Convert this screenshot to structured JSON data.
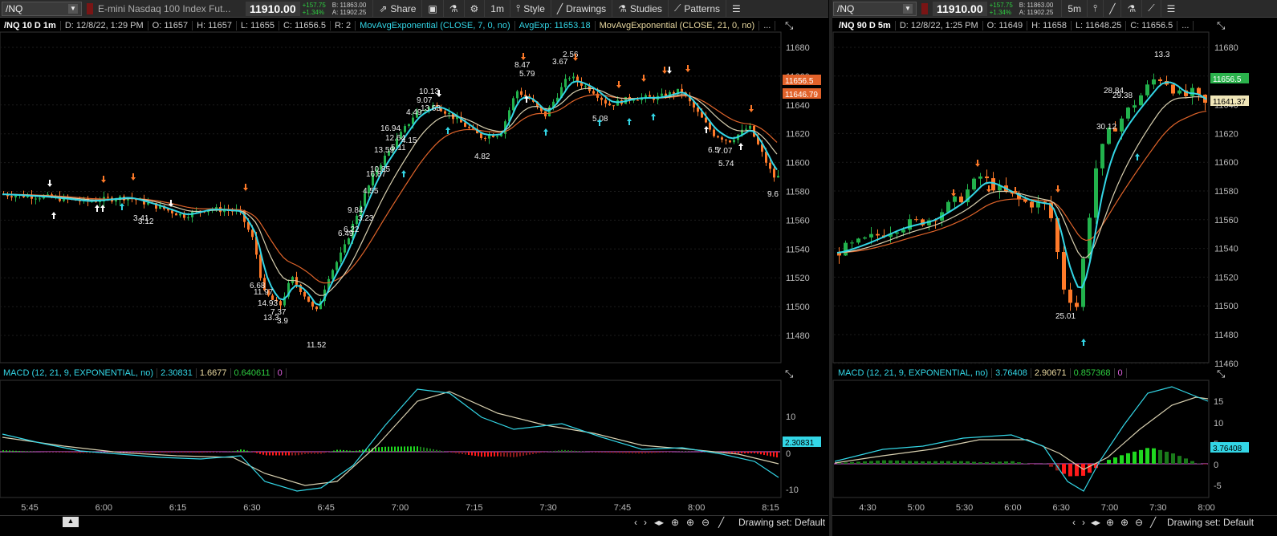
{
  "colors": {
    "up": "#22b24c",
    "down": "#ff7a29",
    "ema7": "#33d6e6",
    "ema_mid": "#d8d0b0",
    "ema21": "#e0642a",
    "macd": "#33d6e6",
    "signal": "#d8d0b0",
    "hist_up": "#1fd81f",
    "hist_up_dim": "#1a7a1a",
    "hist_down": "#ff1a1a",
    "hist_down_dim": "#8a1a1a"
  },
  "left": {
    "toolbar": {
      "symbol": "/NQ",
      "description": "E-mini Nasdaq 100 Index Fut...",
      "price": "11910.00",
      "change": "+157.75",
      "change_pct": "+1.34%",
      "bid": "B: 11863.00",
      "ask": "A: 11902.25",
      "share": "Share",
      "interval": "1m",
      "style": "Style",
      "drawings": "Drawings",
      "studies": "Studies",
      "patterns": "Patterns"
    },
    "header": {
      "title": "/NQ 10 D 1m",
      "date": "D: 12/8/22, 1:29 PM",
      "open": "O: 11657",
      "high": "H: 11657",
      "low": "L: 11655",
      "close": "C: 11656.5",
      "range": "R: 2",
      "ema7_name": "MovAvgExponential (CLOSE, 7, 0, no)",
      "ema7_value": "AvgExp: 11653.18",
      "ema21_name": "MovAvgExponential (CLOSE, 21, 0, no)",
      "more": "..."
    },
    "price_ticks": [
      "11680",
      "11660",
      "11640",
      "11620",
      "11600",
      "11580",
      "11560",
      "11540",
      "11520",
      "11500",
      "11480"
    ],
    "price_tags": [
      "11656.5",
      "11646.79"
    ],
    "annotations": [
      "8.47",
      "2.56",
      "3.67",
      "5.79",
      "10.13",
      "9.07",
      "13.63",
      "4.49",
      "16.94",
      "12.64",
      "4.15",
      "5.11",
      "13.59",
      "10.85",
      "16.87",
      "4.55",
      "9.84",
      "3.23",
      "6.22",
      "6.49",
      "3.41",
      "3.12",
      "4.82",
      "5.08",
      "6.5",
      "7.07",
      "5.74",
      "9.6",
      "6.68",
      "11.97",
      "14.93",
      "7.37",
      "13.3",
      "3.9",
      "11.52"
    ],
    "macd_header": {
      "name": "MACD (12, 21, 9, EXPONENTIAL, no)",
      "v1": "2.30831",
      "v2": "1.6677",
      "v3": "0.640611",
      "v4": "0"
    },
    "macd_ticks": [
      "10",
      "0",
      "-10"
    ],
    "macd_tag": "2.30831",
    "time_ticks": [
      "5:45",
      "6:00",
      "6:15",
      "6:30",
      "6:45",
      "7:00",
      "7:15",
      "7:30",
      "7:45",
      "8:00",
      "8:15"
    ],
    "drawing_set": "Drawing set: Default"
  },
  "right": {
    "toolbar": {
      "symbol": "/NQ",
      "price": "11910.00",
      "change": "+157.75",
      "change_pct": "+1.34%",
      "bid": "B: 11863.00",
      "ask": "A: 11902.25",
      "interval": "5m"
    },
    "header": {
      "title": "/NQ 90 D 5m",
      "date": "D: 12/8/22, 1:25 PM",
      "open": "O: 11649",
      "high": "H: 11658",
      "low": "L: 11648.25",
      "close": "C: 11656.5",
      "more": "..."
    },
    "price_ticks": [
      "11680",
      "11660",
      "11640",
      "11620",
      "11600",
      "11580",
      "11560",
      "11540",
      "11520",
      "11500",
      "11480",
      "11460"
    ],
    "price_tags": [
      "11656.5",
      "11641.37"
    ],
    "annotations": [
      "13.3",
      "28.84",
      "29.38",
      "30.12",
      "25.01"
    ],
    "macd_header": {
      "name": "MACD (12, 21, 9, EXPONENTIAL, no)",
      "v1": "3.76408",
      "v2": "2.90671",
      "v3": "0.857368",
      "v4": "0"
    },
    "macd_ticks": [
      "15",
      "10",
      "5",
      "0",
      "-5"
    ],
    "macd_tag": "3.76408",
    "time_ticks": [
      "4:30",
      "5:00",
      "5:30",
      "6:00",
      "6:30",
      "7:00",
      "7:30",
      "8:00"
    ],
    "drawing_set": "Drawing set: Default"
  }
}
